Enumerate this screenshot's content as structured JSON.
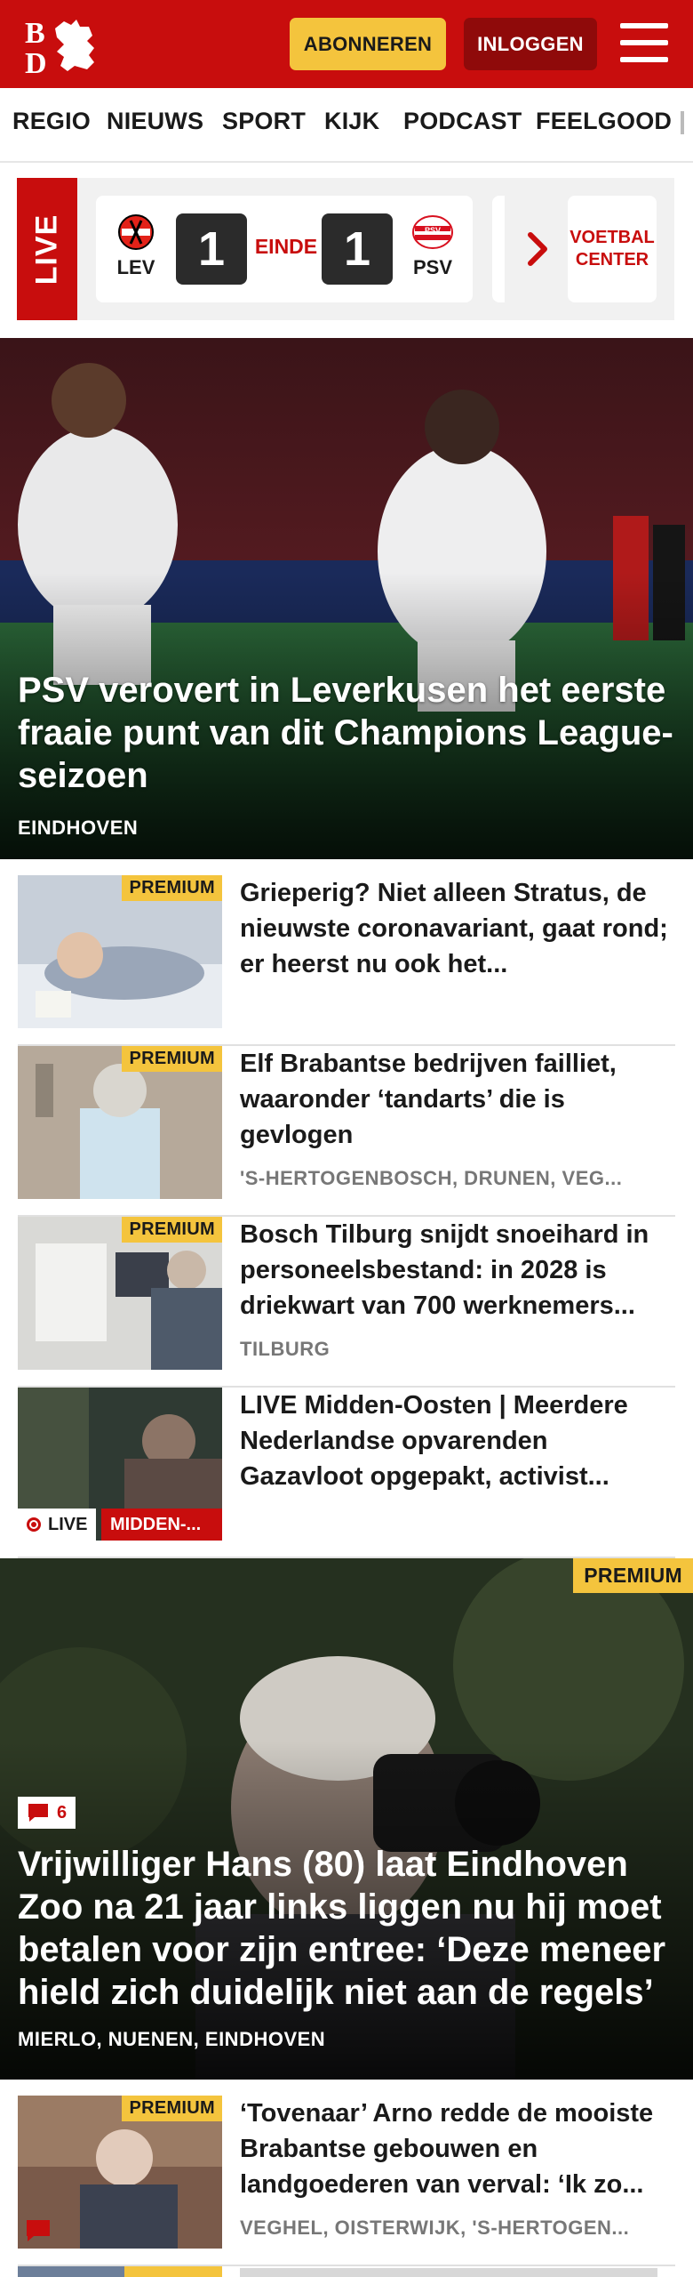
{
  "header": {
    "subscribe_label": "ABONNEREN",
    "login_label": "INLOGGEN"
  },
  "nav": {
    "items": [
      "REGIO",
      "NIEUWS",
      "SPORT",
      "KIJK",
      "PODCAST",
      "FEELGOOD"
    ]
  },
  "live": {
    "tag": "LIVE",
    "home_team": "LEV",
    "away_team": "PSV",
    "home_score": "1",
    "away_score": "1",
    "status": "EINDE",
    "center_label_line1": "VOETBAL",
    "center_label_line2": "CENTER"
  },
  "hero": {
    "title": "PSV verovert in Leverkusen het eerste fraaie punt van dit Champions League-seizoen",
    "location": "EINDHOVEN"
  },
  "premium_label": "PREMIUM",
  "articles": [
    {
      "title": "Grieperig? Niet alleen Stratus, de nieuwste coronavariant, gaat rond; er heerst nu ook het...",
      "location": ""
    },
    {
      "title": "Elf Brabantse bedrijven failliet, waaronder ‘tandarts’ die is gevlogen",
      "location": "'S-HERTOGENBOSCH, DRUNEN, VEG..."
    },
    {
      "title": "Bosch Tilburg snijdt snoeihard in personeelsbestand: in 2028 is driekwart van 700 werknemers...",
      "location": "TILBURG"
    },
    {
      "title": "LIVE Midden-Oosten | Meerdere Nederlandse opvarenden Gazavloot opgepakt, activist...",
      "live_label": "LIVE",
      "topic_label": "MIDDEN-..."
    }
  ],
  "feature": {
    "comments": "6",
    "title": "Vrijwilliger Hans (80) laat Eindhoven Zoo na 21 jaar links liggen nu hij moet betalen voor zijn entree: ‘Deze meneer hield zich duidelijk niet aan de regels’",
    "location": "MIERLO, NUENEN, EINDHOVEN"
  },
  "article_after": {
    "title": "‘Tovenaar’ Arno redde de mooiste Brabantse gebouwen en landgoederen van verval: ‘Ik zo...",
    "location": "VEGHEL, OISTERWIJK, 'S-HERTOGEN..."
  },
  "colors": {
    "brand_red": "#c80d0d",
    "premium_yellow": "#f4c43d",
    "login_dark_red": "#8f0a0a"
  }
}
